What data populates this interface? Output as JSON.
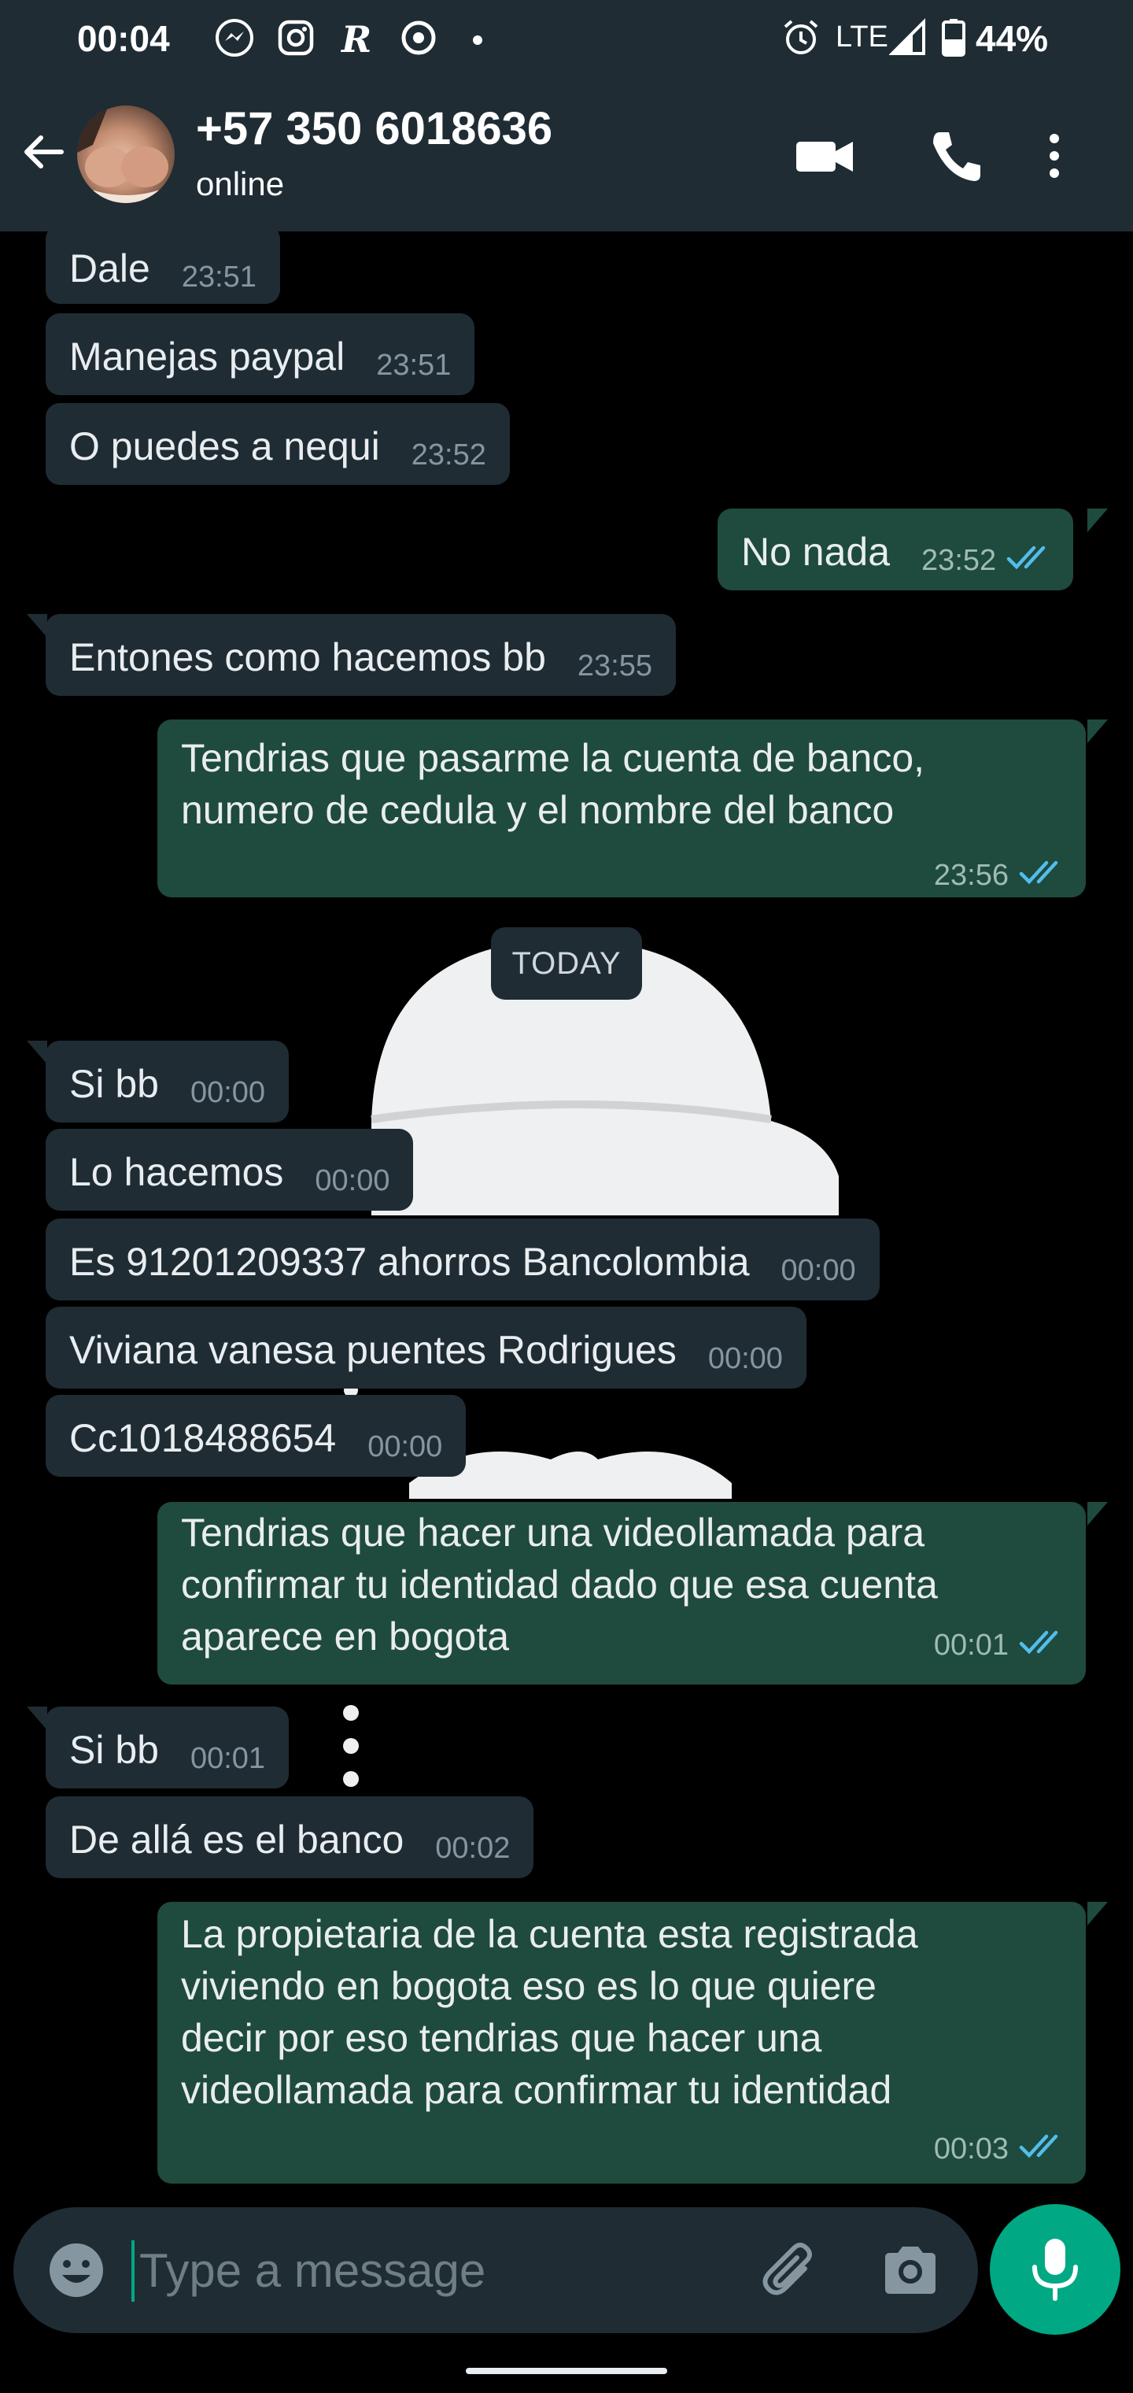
{
  "status_bar": {
    "time": "00:04",
    "network": "LTE",
    "battery": "44%",
    "icons": [
      "messenger-icon",
      "instagram-icon",
      "r-app-icon",
      "chrome-icon",
      "dot",
      "alarm-icon",
      "signal-icon",
      "battery-icon"
    ]
  },
  "header": {
    "contact_name": "+57 350 6018636",
    "status": "online",
    "icons": [
      "back-arrow-icon",
      "video-call-icon",
      "voice-call-icon",
      "more-options-icon"
    ]
  },
  "messages": [
    {
      "dir": "in",
      "text": "Dale",
      "time": "23:51"
    },
    {
      "dir": "in",
      "text": "Manejas paypal",
      "time": "23:51"
    },
    {
      "dir": "in",
      "text": "O puedes a nequi",
      "time": "23:52"
    },
    {
      "dir": "out",
      "text": "No nada",
      "time": "23:52"
    },
    {
      "dir": "in",
      "text": "Entones como hacemos bb",
      "time": "23:55"
    },
    {
      "dir": "out",
      "lines": [
        "Tendrias que pasarme la cuenta de banco,",
        "numero de cedula y el nombre del banco"
      ],
      "time": "23:56"
    },
    {
      "dir": "in",
      "text": "Si bb",
      "time": "00:00"
    },
    {
      "dir": "in",
      "text": "Lo hacemos",
      "time": "00:00"
    },
    {
      "dir": "in",
      "text": "Es 91201209337 ahorros Bancolombia",
      "time": "00:00"
    },
    {
      "dir": "in",
      "text": "Viviana vanesa puentes Rodrigues",
      "time": "00:00"
    },
    {
      "dir": "in",
      "text": "Cc1018488654",
      "time": "00:00"
    },
    {
      "dir": "out",
      "lines": [
        "Tendrias que hacer una videollamada para",
        "confirmar tu identidad dado que esa cuenta",
        "aparece en bogota"
      ],
      "time": "00:01"
    },
    {
      "dir": "in",
      "text": "Si bb",
      "time": "00:01"
    },
    {
      "dir": "in",
      "text": "De allá es el banco",
      "time": "00:02"
    },
    {
      "dir": "out",
      "lines": [
        "La propietaria de la cuenta esta registrada",
        "viviendo en bogota eso es lo que quiere",
        "decir por eso tendrias que hacer una",
        "videollamada para confirmar tu identidad"
      ],
      "time": "00:03"
    }
  ],
  "date_divider": "TODAY",
  "composer": {
    "placeholder": "Type a message",
    "icons": [
      "emoji-icon",
      "attach-icon",
      "camera-icon",
      "mic-icon"
    ]
  },
  "colors": {
    "header_bg": "#1f2c34",
    "incoming_bubble": "#1f2c34",
    "outgoing_bubble": "#1f4a3e",
    "accent": "#00a884",
    "read_ticks": "#53bdeb"
  }
}
